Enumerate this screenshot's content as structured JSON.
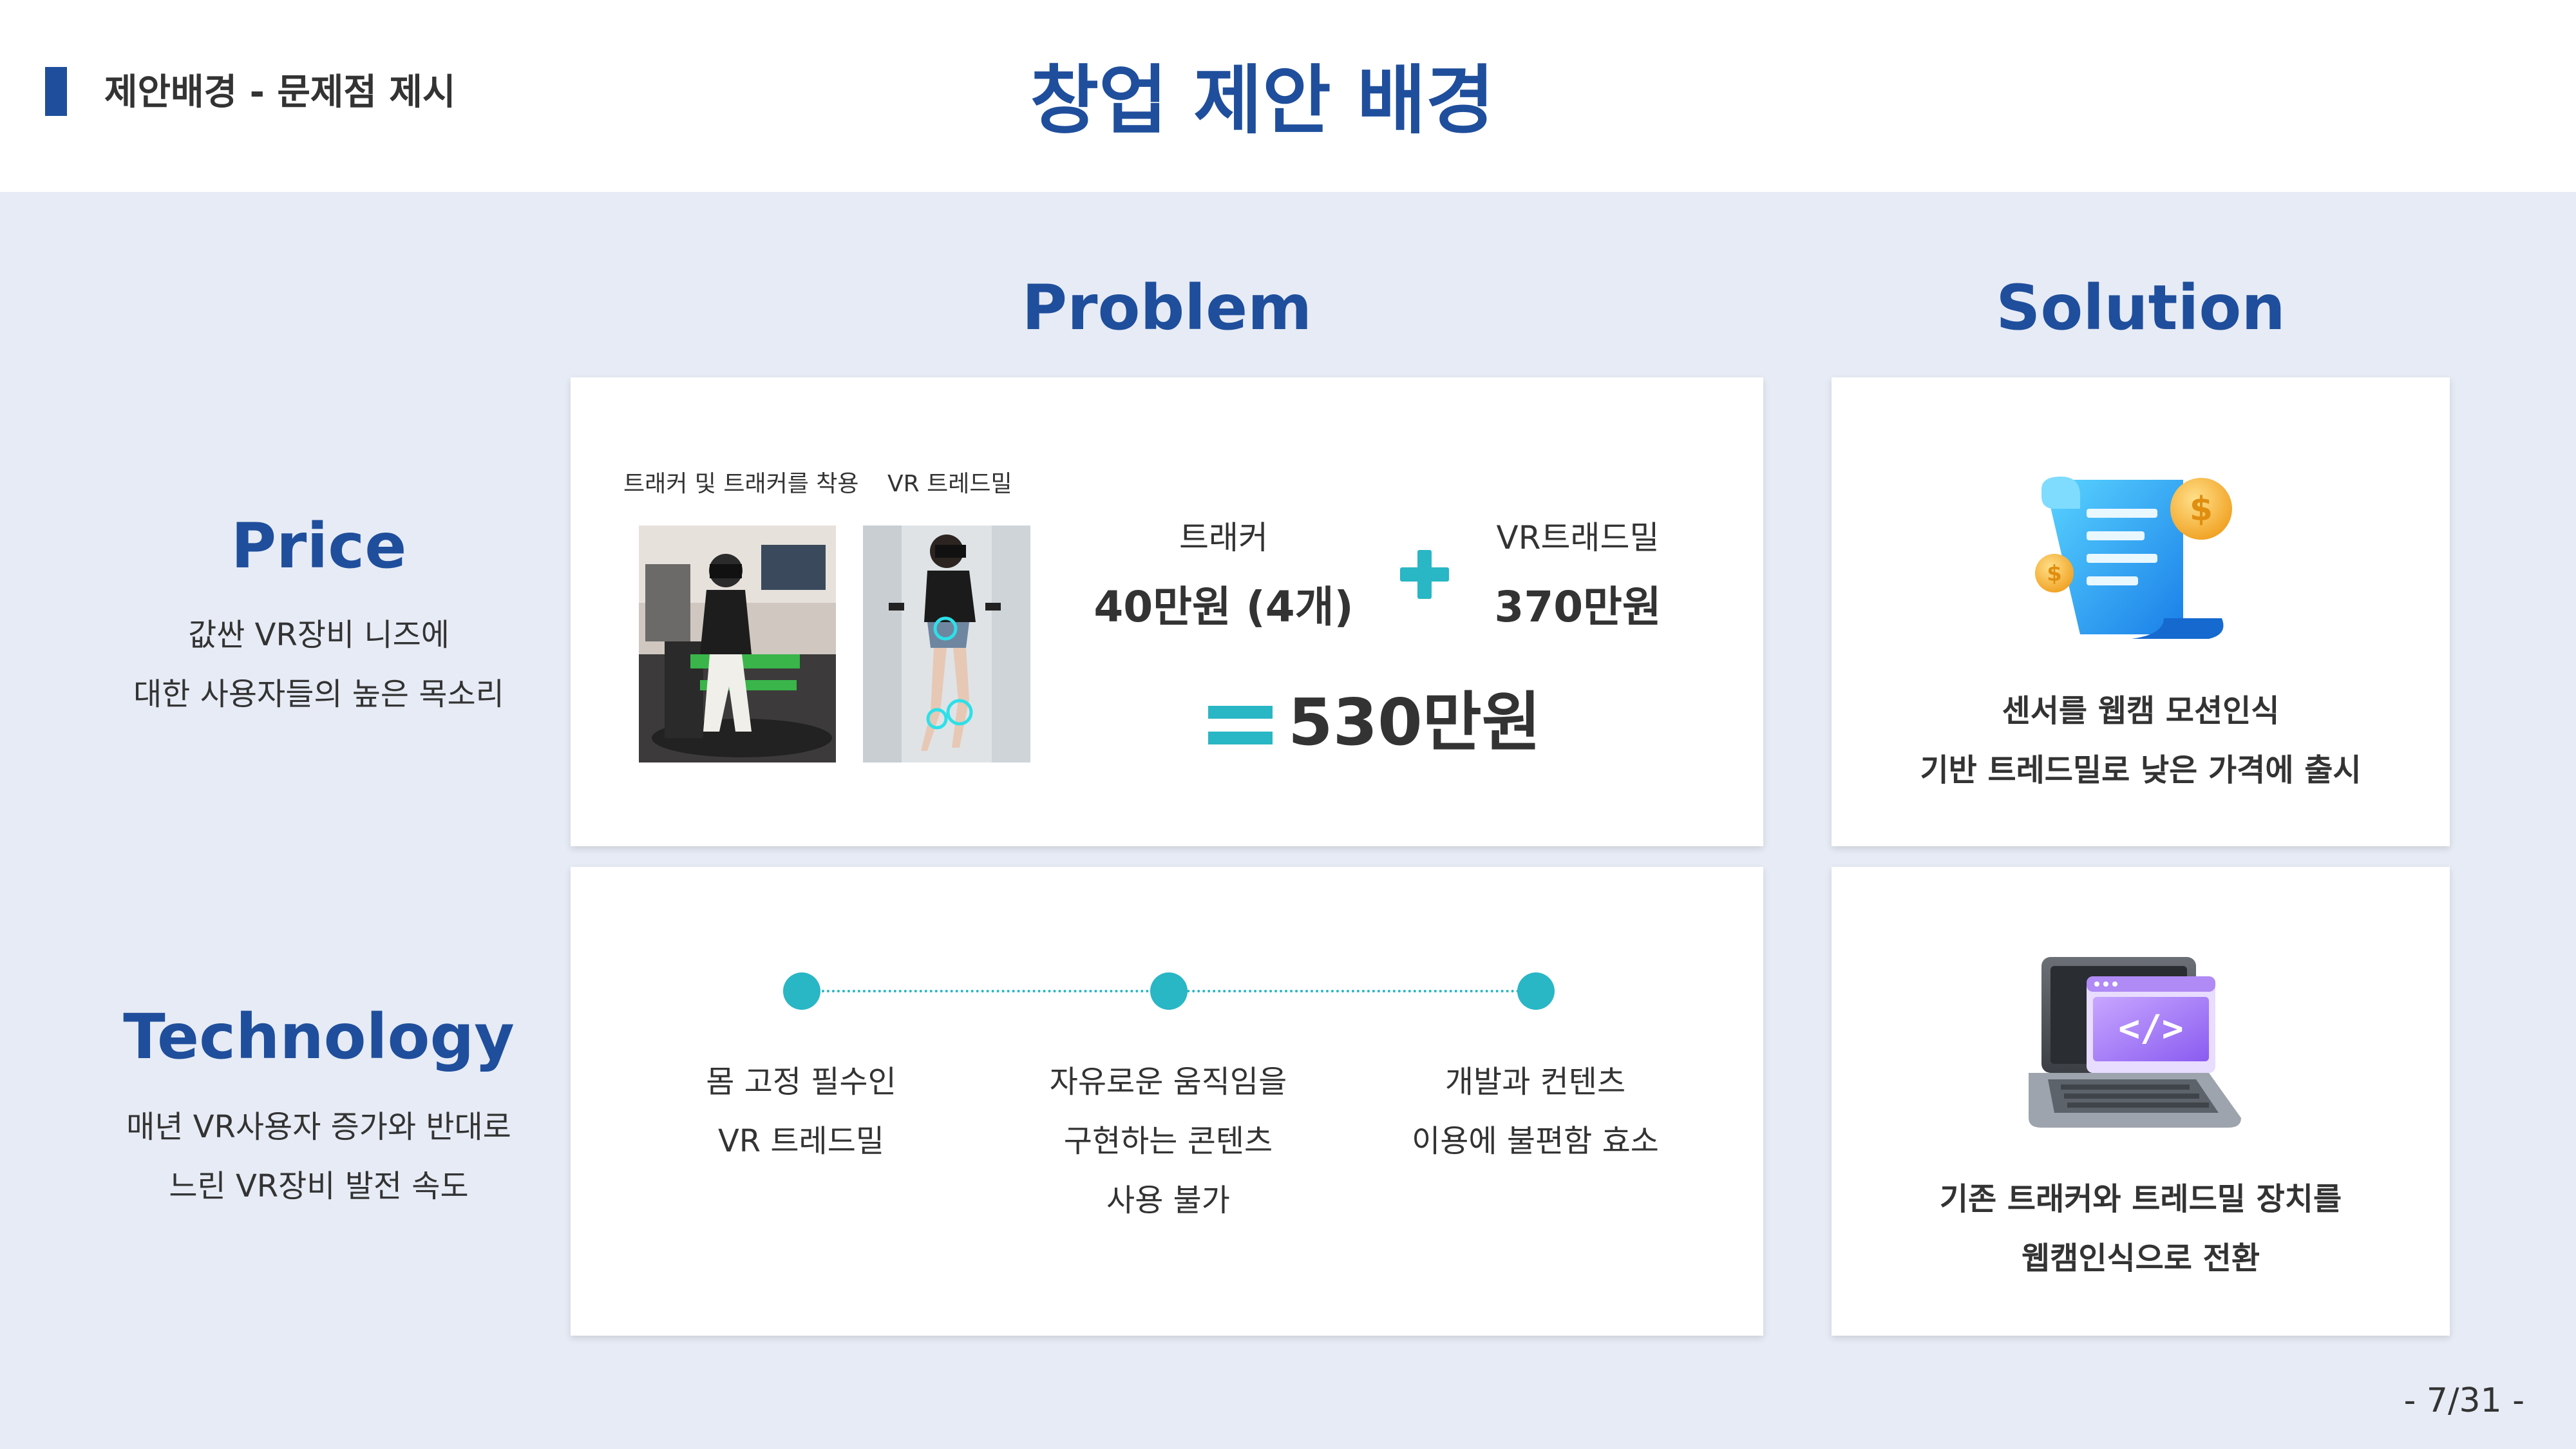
{
  "header": {
    "section": "제안배경 - 문제점 제시",
    "title": "창업 제안 배경"
  },
  "columns": {
    "problem": "Problem",
    "solution": "Solution"
  },
  "rows": {
    "price": {
      "label": "Price",
      "desc_line1": "값싼 VR장비 니즈에",
      "desc_line2": "대한 사용자들의 높은 목소리"
    },
    "technology": {
      "label": "Technology",
      "desc_line1": "매년 VR사용자 증가와 반대로",
      "desc_line2": "느린 VR장비 발전 속도"
    }
  },
  "price_problem": {
    "caption_tracker": "트래커 및 트래커를 착용",
    "caption_treadmill": "VR 트레드밀",
    "tracker_name": "트래커",
    "tracker_price": "40만원 (4개)",
    "vr_name": "VR트래드밀",
    "vr_price": "370만원",
    "total": "530만원",
    "accent_color": "#29b6c5"
  },
  "price_solution": {
    "line1": "센서를 웹캠 모션인식",
    "line2": "기반 트레드밀로 낮은 가격에 출시",
    "icon": "receipt-coins-icon"
  },
  "tech_problem": {
    "items": [
      {
        "line1": "몸 고정 필수인",
        "line2": "VR 트레드밀",
        "line3": ""
      },
      {
        "line1": "자유로운 움직임을",
        "line2": "구현하는 콘텐츠",
        "line3": "사용 불가"
      },
      {
        "line1": "개발과 컨텐츠",
        "line2": "이용에 불편함 효소",
        "line3": ""
      }
    ]
  },
  "tech_solution": {
    "line1": "기존 트래커와 트레드밀 장치를",
    "line2": "웹캠인식으로 전환",
    "icon": "laptop-code-icon"
  },
  "page_number": "- 7/31 -",
  "colors": {
    "brand": "#1f4e9c",
    "accent": "#29b6c5",
    "background": "#e6ebf5"
  }
}
